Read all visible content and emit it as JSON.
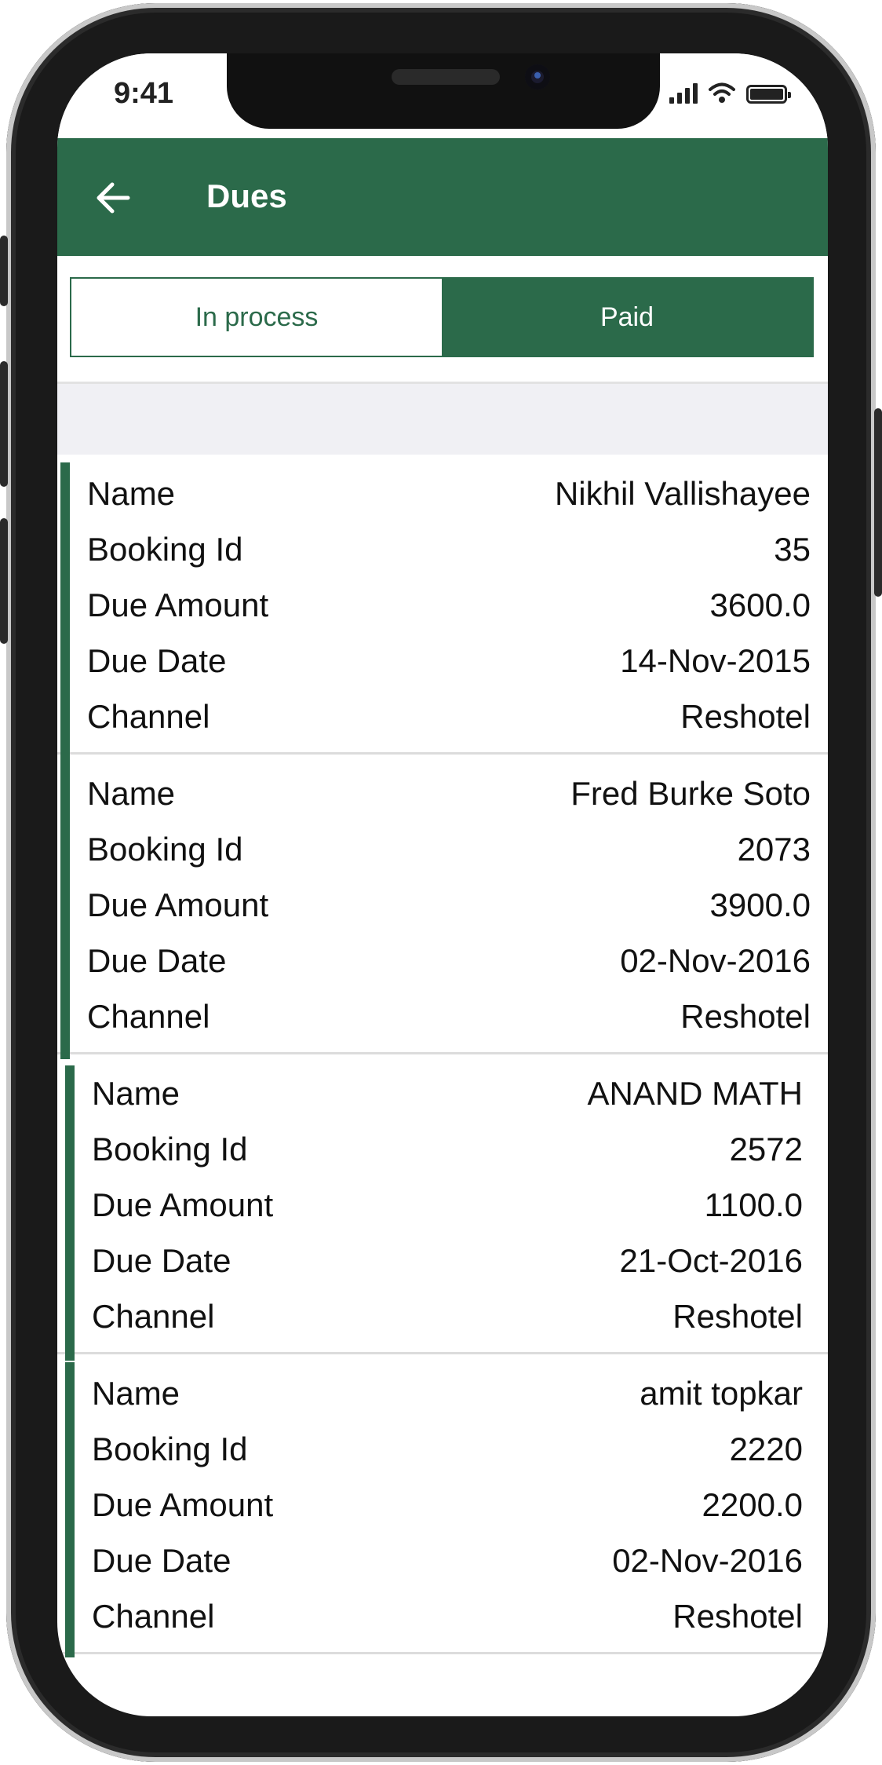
{
  "status_bar": {
    "time": "9:41"
  },
  "app_bar": {
    "title": "Dues",
    "back_icon": "arrow-left-icon"
  },
  "tabs": [
    {
      "label": "In process",
      "selected": false
    },
    {
      "label": "Paid",
      "selected": true
    }
  ],
  "colors": {
    "primary": "#2b6a4a",
    "tab_active_text": "#ffffff",
    "divider": "#dcdcdc",
    "band": "#f0f0f4"
  },
  "dues": [
    {
      "rows": [
        {
          "label": "Name",
          "value": "Nikhil Vallishayee"
        },
        {
          "label": "Booking Id",
          "value": "35"
        },
        {
          "label": "Due Amount",
          "value": "3600.0"
        },
        {
          "label": "Due Date",
          "value": "14-Nov-2015"
        },
        {
          "label": "Channel",
          "value": "Reshotel"
        }
      ]
    },
    {
      "rows": [
        {
          "label": "Name",
          "value": "Fred Burke Soto"
        },
        {
          "label": "Booking Id",
          "value": "2073"
        },
        {
          "label": "Due Amount",
          "value": "3900.0"
        },
        {
          "label": "Due Date",
          "value": "02-Nov-2016"
        },
        {
          "label": "Channel",
          "value": "Reshotel"
        }
      ]
    },
    {
      "rows": [
        {
          "label": "Name",
          "value": "ANAND MATH"
        },
        {
          "label": "Booking Id",
          "value": "2572"
        },
        {
          "label": "Due Amount",
          "value": "1100.0"
        },
        {
          "label": "Due Date",
          "value": "21-Oct-2016"
        },
        {
          "label": "Channel",
          "value": "Reshotel"
        }
      ]
    },
    {
      "rows": [
        {
          "label": "Name",
          "value": "amit topkar"
        },
        {
          "label": "Booking Id",
          "value": "2220"
        },
        {
          "label": "Due Amount",
          "value": "2200.0"
        },
        {
          "label": "Due Date",
          "value": "02-Nov-2016"
        },
        {
          "label": "Channel",
          "value": "Reshotel"
        }
      ]
    }
  ]
}
